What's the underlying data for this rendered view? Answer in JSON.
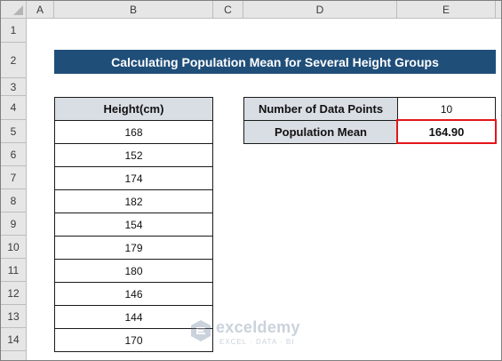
{
  "columns": [
    "A",
    "B",
    "C",
    "D",
    "E"
  ],
  "rows": [
    "1",
    "2",
    "3",
    "4",
    "5",
    "6",
    "7",
    "8",
    "9",
    "10",
    "11",
    "12",
    "13",
    "14"
  ],
  "title": "Calculating Population Mean for Several Height Groups",
  "heights": {
    "header": "Height(cm)",
    "values": [
      "168",
      "152",
      "174",
      "182",
      "154",
      "179",
      "180",
      "146",
      "144",
      "170"
    ]
  },
  "summary": {
    "count_label": "Number of Data Points",
    "count_value": "10",
    "mean_label": "Population Mean",
    "mean_value": "164.90"
  },
  "highlight_color": "#e3151a",
  "title_bg": "#1f4e79",
  "watermark": {
    "name": "exceldemy",
    "tagline": "EXCEL · DATA · BI",
    "icon": "exceldemy-logo-icon"
  }
}
